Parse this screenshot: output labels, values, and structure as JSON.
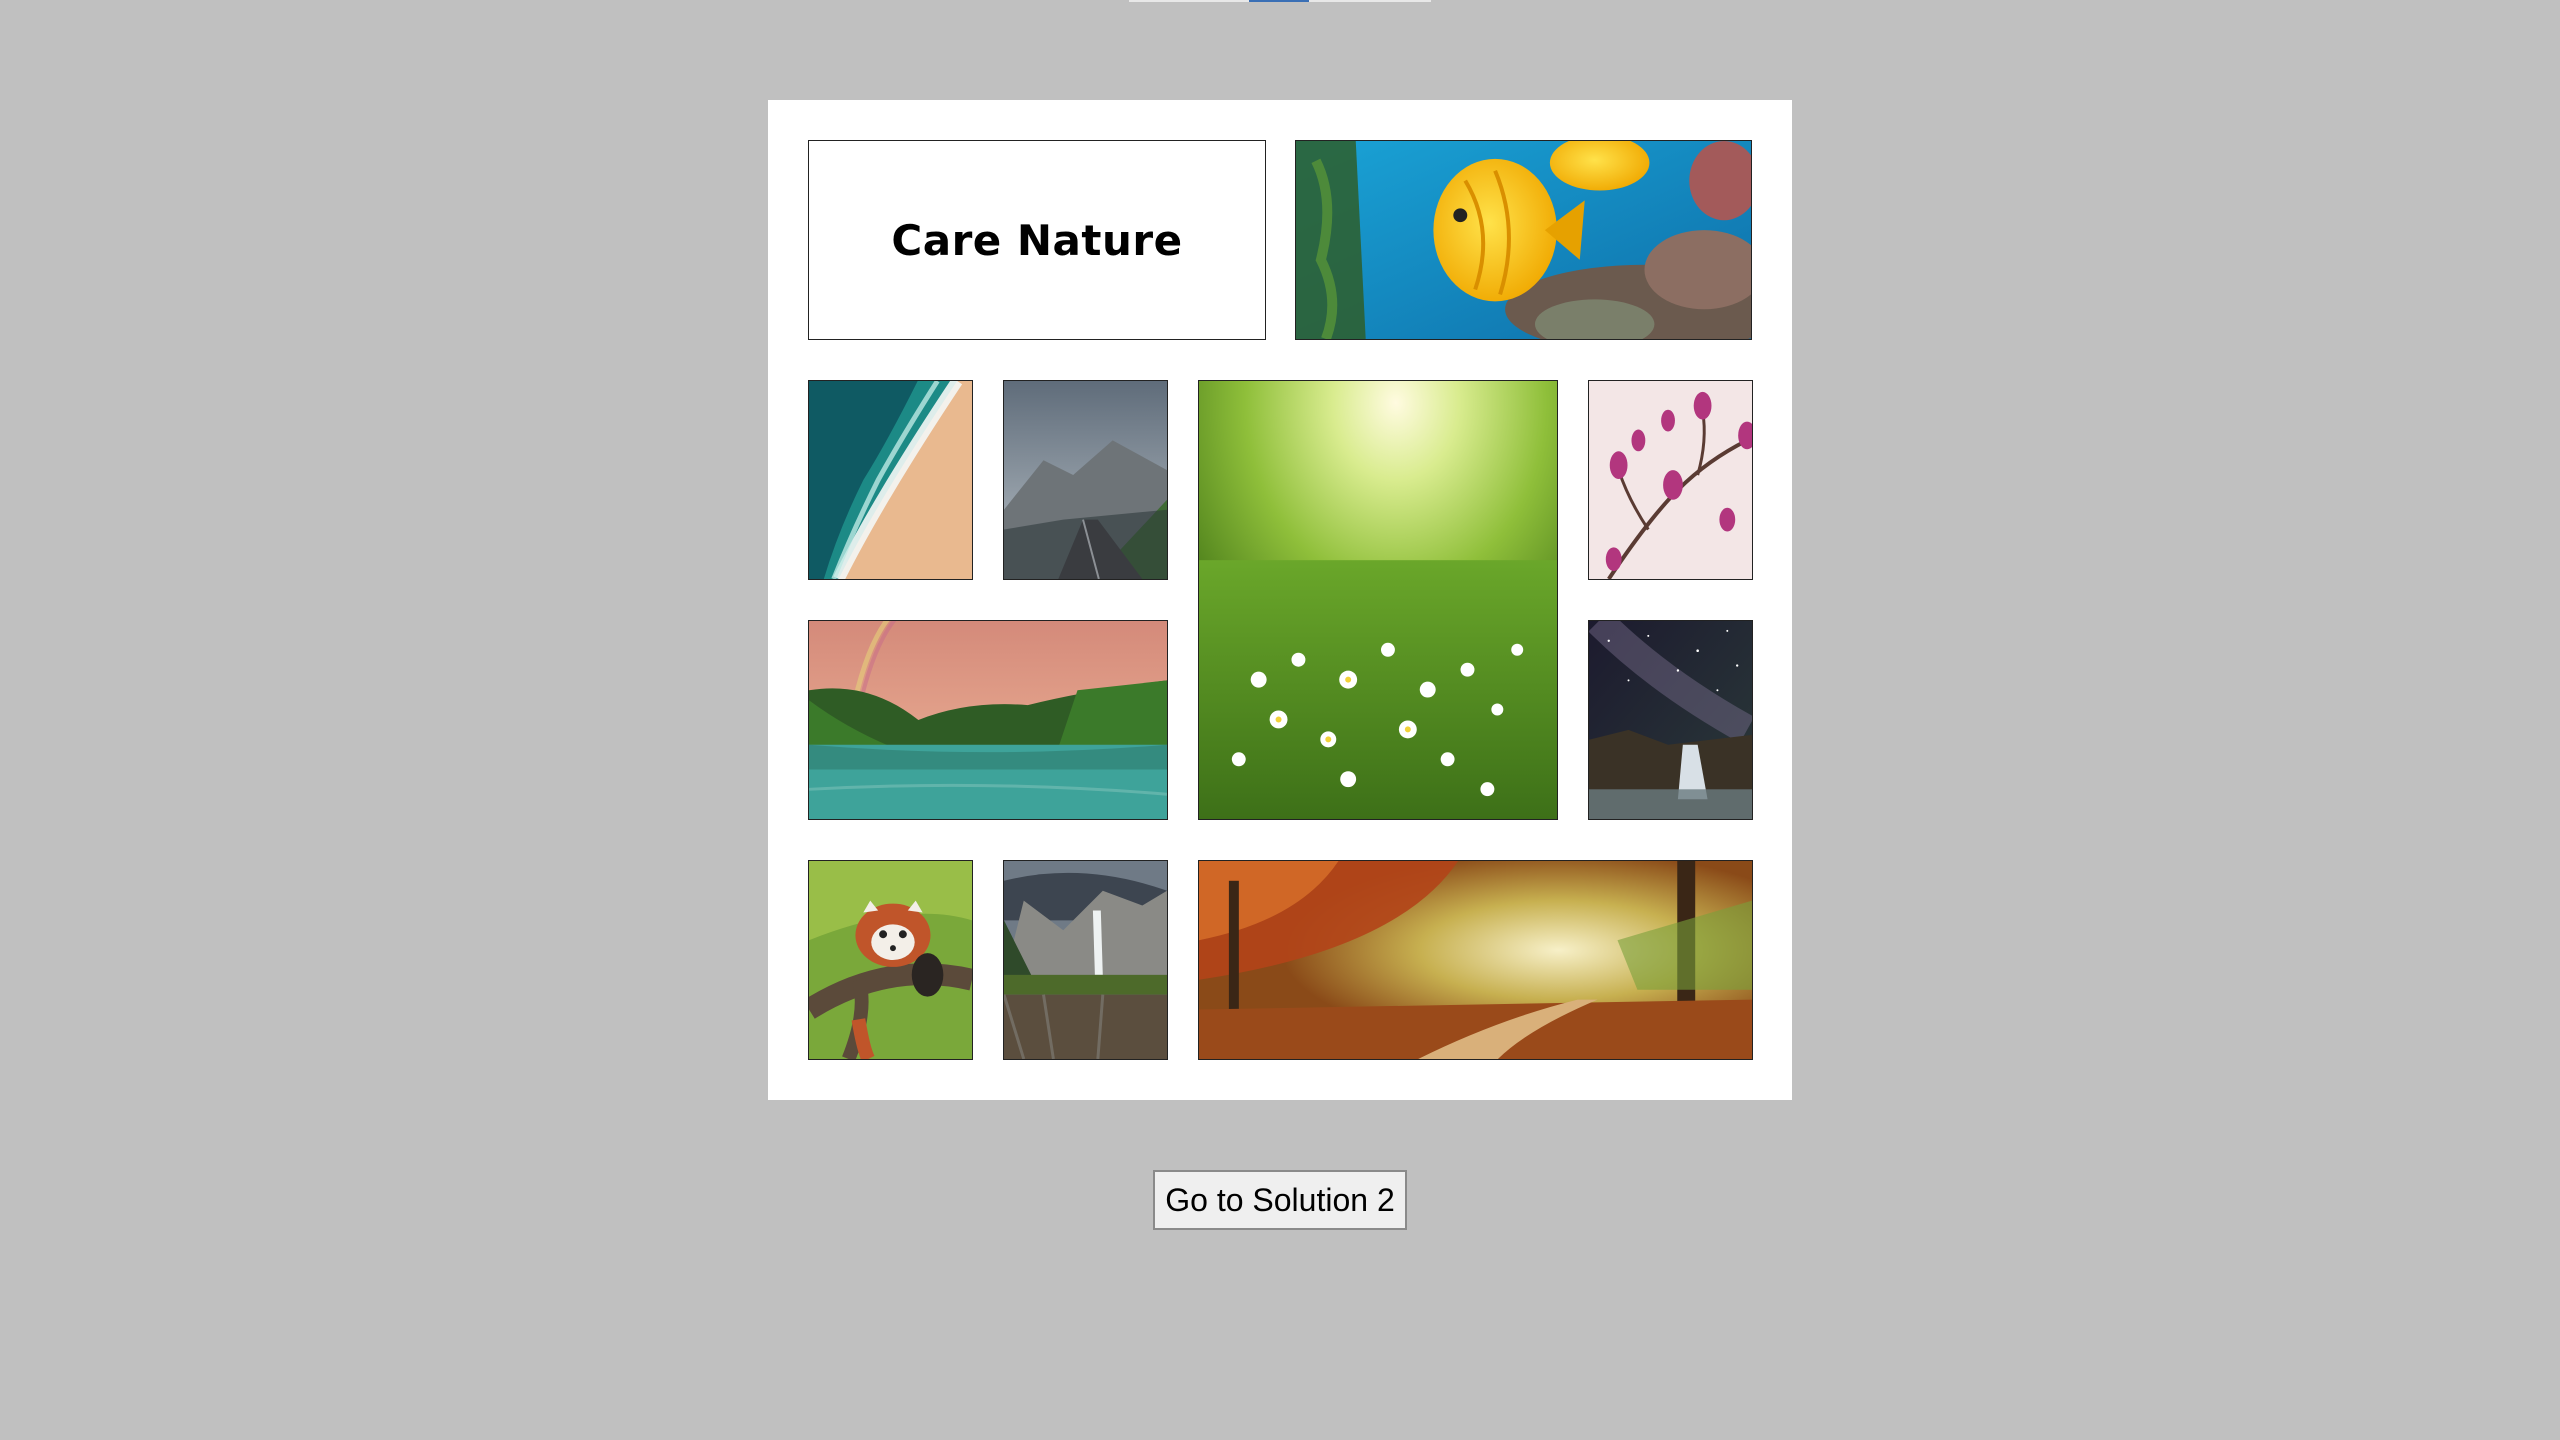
{
  "collage": {
    "title": "Care Nature",
    "photos": [
      {
        "name": "tropical-fish-photo",
        "subject": "yellow butterflyfish over coral reef"
      },
      {
        "name": "beach-shore-photo",
        "subject": "aerial turquoise waves on sandy beach"
      },
      {
        "name": "mountain-road-photo",
        "subject": "wet road leading into misty mountains"
      },
      {
        "name": "sunny-meadow-photo",
        "subject": "sunlit meadow with white flowers"
      },
      {
        "name": "magnolia-blossom-photo",
        "subject": "pink magnolia blossoms"
      },
      {
        "name": "river-rainbow-photo",
        "subject": "green river valley with rainbow at sunset"
      },
      {
        "name": "milky-way-waterfall-photo",
        "subject": "starry night sky over waterfall"
      },
      {
        "name": "red-panda-photo",
        "subject": "red panda on a tree branch"
      },
      {
        "name": "valley-waterfall-photo",
        "subject": "waterfall in mountain valley with reflection"
      },
      {
        "name": "autumn-forest-photo",
        "subject": "autumn forest path in golden light"
      }
    ]
  },
  "button": {
    "label": "Go to Solution 2"
  },
  "colors": {
    "page_background": "#c0c0c0",
    "card_background": "#ffffff",
    "border": "#222222"
  }
}
